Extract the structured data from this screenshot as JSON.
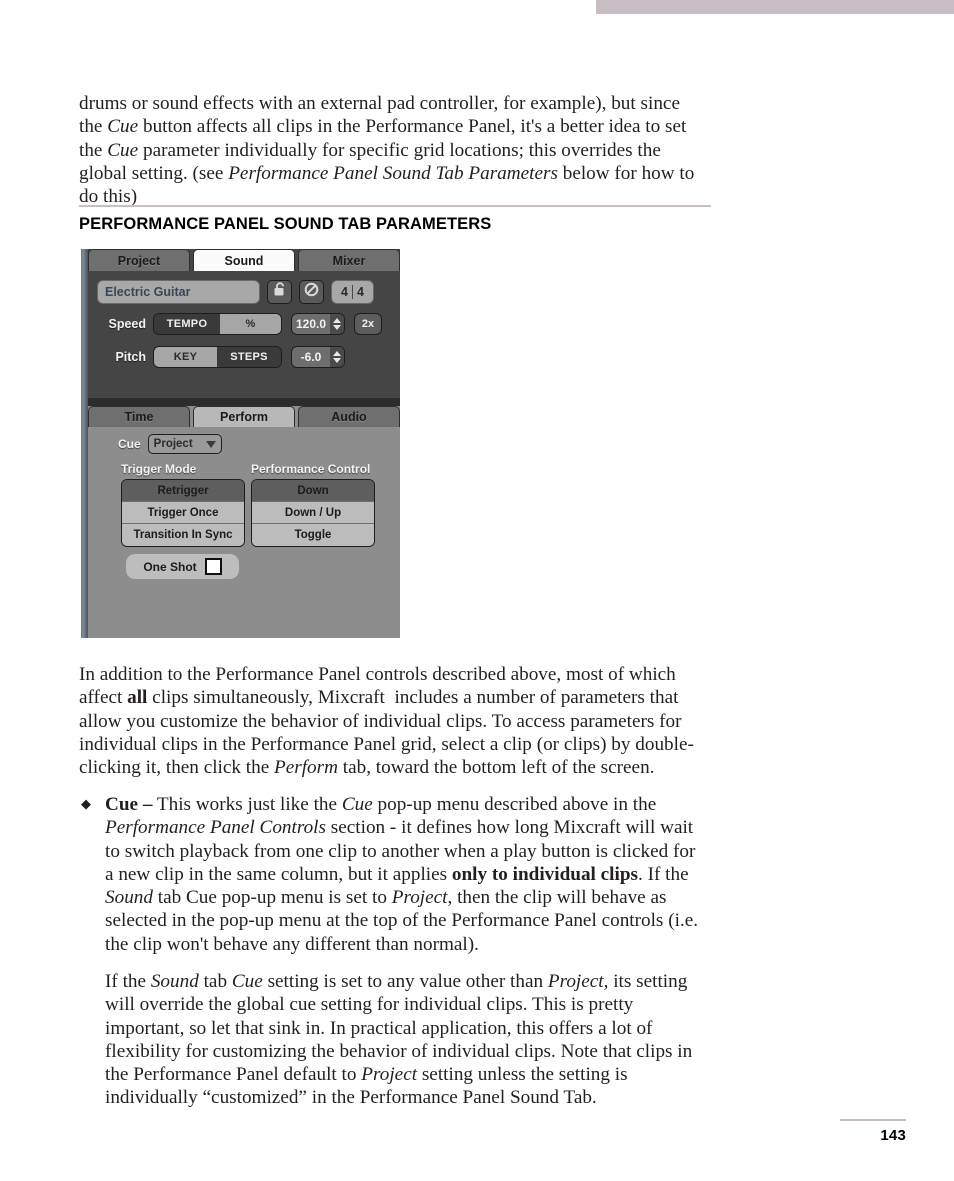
{
  "page": {
    "number": "143",
    "accent_color": "#c9bec4"
  },
  "paragraphs": {
    "intro": "drums or sound effects with an external pad controller, for example), but since the Cue button affects all clips in the Performance Panel, it's a better idea to set the Cue parameter individually for specific grid locations; this overrides the global setting. (see Performance Panel Sound Tab Parameters below for how to do this)",
    "addition": "In addition to the Performance Panel controls described above, most of which affect all clips simultaneously, Mixcraft  includes a number of parameters that allow you customize the behavior of individual clips. To access parameters for individual clips in the Performance Panel grid, select a clip (or clips) by double-clicking it, then click the Perform tab, toward the bottom left of the screen.",
    "bullet_cue": "Cue – This works just like the Cue pop-up menu described above in the Performance Panel Controls section - it defines how long Mixcraft will wait to switch playback from one clip to another when a play button is clicked for a new clip in the same column, but it applies only to individual clips. If the Sound tab Cue pop-up menu is set to Project, then the clip will behave as selected in the pop-up menu at the top of the Performance Panel controls (i.e. the clip won't behave any different than normal).",
    "sub_cue": "If the Sound tab Cue setting is set to any value other than Project, its setting will override the global cue setting for individual clips. This is pretty important, so let that sink in. In practical application, this offers a lot of flexibility for customizing the behavior of individual clips. Note that clips in the Performance Panel default to Project setting unless the setting is individually “customized” in the Performance Panel Sound Tab."
  },
  "section": {
    "title": "PERFORMANCE PANEL SOUND TAB PARAMETERS"
  },
  "figure": {
    "top_tabs": [
      {
        "label": "Project",
        "active": false
      },
      {
        "label": "Sound",
        "active": true
      },
      {
        "label": "Mixer",
        "active": false
      }
    ],
    "instrument": {
      "name": "Electric Guitar",
      "lock_icon": "open-padlock-icon",
      "mute_icon": "prohibited-circle-icon",
      "time_signature_numerator": "4",
      "time_signature_denominator": "4"
    },
    "speed": {
      "label": "Speed",
      "mode_options": [
        "TEMPO",
        "%"
      ],
      "mode_selected": "TEMPO",
      "value": "120.0",
      "multiplier": "2x"
    },
    "pitch": {
      "label": "Pitch",
      "mode_options": [
        "KEY",
        "STEPS"
      ],
      "mode_selected": "STEPS",
      "value": "-6.0"
    },
    "bottom_tabs": [
      {
        "label": "Time",
        "active": false
      },
      {
        "label": "Perform",
        "active": true
      },
      {
        "label": "Audio",
        "active": false
      }
    ],
    "cue": {
      "label": "Cue",
      "value": "Project",
      "caret_icon": "chevron-down-icon"
    },
    "trigger_mode": {
      "label": "Trigger Mode",
      "options": [
        "Retrigger",
        "Trigger Once",
        "Transition In Sync"
      ],
      "selected": "Retrigger"
    },
    "performance_control": {
      "label": "Performance Control",
      "options": [
        "Down",
        "Down / Up",
        "Toggle"
      ],
      "selected": "Down"
    },
    "one_shot": {
      "label": "One Shot",
      "checked": false
    }
  }
}
